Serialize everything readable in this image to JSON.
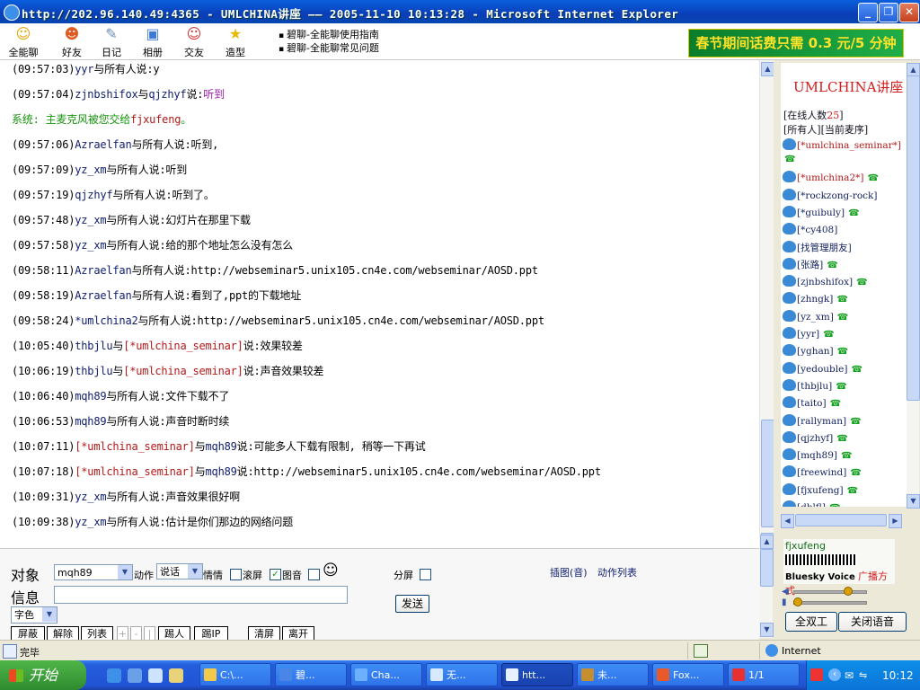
{
  "window": {
    "title": "http://202.96.140.49:4365 - UMLCHINA讲座 —— 2005-11-10 10:13:28 - Microsoft Internet Explorer"
  },
  "toolbar": {
    "items": [
      {
        "label": "全能聊",
        "icon": "smile-icon"
      },
      {
        "label": "好友",
        "icon": "friends-icon"
      },
      {
        "label": "日记",
        "icon": "diary-icon"
      },
      {
        "label": "相册",
        "icon": "album-icon"
      },
      {
        "label": "交友",
        "icon": "dating-icon"
      },
      {
        "label": "造型",
        "icon": "star-icon"
      }
    ],
    "help_links": [
      "碧聊-全能聊使用指南",
      "碧聊-全能聊常见问题"
    ],
    "ad_text": "春节期间话费只需 0.3 元/5 分钟"
  },
  "chat": {
    "messages": [
      {
        "time": "(09:57:03)",
        "from": "yyr",
        "mid": "与所有人说:",
        "to": "",
        "mid2": "",
        "text": "y",
        "text_color": "black"
      },
      {
        "time": "(09:57:04)",
        "from": "zjnbshifox",
        "mid": "与",
        "to": "qjzhyf",
        "mid2": "说:",
        "text": "听到",
        "text_color": "purple"
      },
      {
        "time": "",
        "system": "系统:  主麦克风被您交给",
        "system_name": "fjxufeng",
        "system_end": "。"
      },
      {
        "time": "(09:57:06)",
        "from": "Azraelfan",
        "mid": "与所有人说:",
        "to": "",
        "mid2": "",
        "text": "听到,",
        "text_color": "black"
      },
      {
        "time": "(09:57:09)",
        "from": "yz_xm",
        "mid": "与所有人说:",
        "to": "",
        "mid2": "",
        "text": "听到",
        "text_color": "black"
      },
      {
        "time": "(09:57:19)",
        "from": "qjzhyf",
        "mid": "与所有人说:",
        "to": "",
        "mid2": "",
        "text": "听到了。",
        "text_color": "black"
      },
      {
        "time": "(09:57:48)",
        "from": "yz_xm",
        "mid": "与所有人说:",
        "to": "",
        "mid2": "",
        "text": "幻灯片在那里下载",
        "text_color": "black"
      },
      {
        "time": "(09:57:58)",
        "from": "yz_xm",
        "mid": "与所有人说:",
        "to": "",
        "mid2": "",
        "text": "给的那个地址怎么没有怎么",
        "text_color": "black"
      },
      {
        "time": "(09:58:11)",
        "from": "Azraelfan",
        "mid": "与所有人说:",
        "to": "",
        "mid2": "",
        "text": "http://webseminar5.unix105.cn4e.com/webseminar/AOSD.ppt",
        "text_color": "black"
      },
      {
        "time": "(09:58:19)",
        "from": "Azraelfan",
        "mid": "与所有人说:",
        "to": "",
        "mid2": "",
        "text": "看到了,ppt的下载地址",
        "text_color": "black"
      },
      {
        "time": "(09:58:24)",
        "from": "*umlchina2",
        "mid": "与所有人说:",
        "to": "",
        "mid2": "",
        "text": "http://webseminar5.unix105.cn4e.com/webseminar/AOSD.ppt",
        "text_color": "black"
      },
      {
        "time": "(10:05:40)",
        "from": "thbjlu",
        "mid": "与",
        "to": "[*umlchina_seminar]",
        "mid2": "说:",
        "text": "效果较差",
        "text_color": "black"
      },
      {
        "time": "(10:06:19)",
        "from": "thbjlu",
        "mid": "与",
        "to": "[*umlchina_seminar]",
        "mid2": "说:",
        "text": "声音效果较差",
        "text_color": "black"
      },
      {
        "time": "(10:06:40)",
        "from": "mqh89",
        "mid": "与所有人说:",
        "to": "",
        "mid2": "",
        "text": "文件下载不了",
        "text_color": "black"
      },
      {
        "time": "(10:06:53)",
        "from": "mqh89",
        "mid": "与所有人说:",
        "to": "",
        "mid2": "",
        "text": "声音时断时续",
        "text_color": "black"
      },
      {
        "time": "(10:07:11)",
        "from": "[*umlchina_seminar]",
        "mid": "与",
        "to": "mqh89",
        "mid2": "说:",
        "text": "可能多人下载有限制, 稍等一下再试",
        "text_color": "black",
        "from_red": true
      },
      {
        "time": "(10:07:18)",
        "from": "[*umlchina_seminar]",
        "mid": "与",
        "to": "mqh89",
        "mid2": "说:",
        "text": "http://webseminar5.unix105.cn4e.com/webseminar/AOSD.ppt",
        "text_color": "black",
        "from_red": true
      },
      {
        "time": "(10:09:31)",
        "from": "yz_xm",
        "mid": "与所有人说:",
        "to": "",
        "mid2": "",
        "text": "声音效果很好啊",
        "text_color": "black"
      },
      {
        "time": "(10:09:38)",
        "from": "yz_xm",
        "mid": "与所有人说:",
        "to": "",
        "mid2": "",
        "text": "估计是你们那边的网络问题",
        "text_color": "black"
      }
    ]
  },
  "users_panel": {
    "room_title": "UMLCHINA讲座",
    "online_prefix": "[在线人数",
    "online_count": "25",
    "online_suffix": "]",
    "link_all": "[所有人]",
    "link_queue": "[当前麦序]",
    "users": [
      {
        "name": "[*umlchina_seminar*]",
        "red": true,
        "phone": true,
        "phone_next_line": true
      },
      {
        "name": "[*umlchina2*]",
        "red": true,
        "phone": true
      },
      {
        "name": "[*rockzong-rock]",
        "red": false,
        "phone": false
      },
      {
        "name": "[*guibuly]",
        "red": false,
        "phone": true
      },
      {
        "name": "[*cy408]",
        "red": false,
        "phone": false
      },
      {
        "name": "[找管理朋友]",
        "red": false,
        "phone": false
      },
      {
        "name": "[张路]",
        "red": false,
        "phone": true
      },
      {
        "name": "[zjnbshifox]",
        "red": false,
        "phone": true
      },
      {
        "name": "[zhngk]",
        "red": false,
        "phone": true
      },
      {
        "name": "[yz_xm]",
        "red": false,
        "phone": true
      },
      {
        "name": "[yyr]",
        "red": false,
        "phone": true
      },
      {
        "name": "[yghan]",
        "red": false,
        "phone": true
      },
      {
        "name": "[yedouble]",
        "red": false,
        "phone": true
      },
      {
        "name": "[thbjlu]",
        "red": false,
        "phone": true
      },
      {
        "name": "[taito]",
        "red": false,
        "phone": true
      },
      {
        "name": "[rallyman]",
        "red": false,
        "phone": true
      },
      {
        "name": "[qjzhyf]",
        "red": false,
        "phone": true
      },
      {
        "name": "[mqh89]",
        "red": false,
        "phone": true
      },
      {
        "name": "[freewind]",
        "red": false,
        "phone": true
      },
      {
        "name": "[fjxufeng]",
        "red": false,
        "phone": true
      },
      {
        "name": "[dblfl]",
        "red": false,
        "phone": true
      }
    ]
  },
  "speaker": {
    "name": "fjxufeng",
    "brand": "Bluesky Voice",
    "mode": "广播方式",
    "full_duplex": "全双工",
    "close_voice": "关闭语音"
  },
  "input": {
    "target_label": "对象",
    "target_value": "mqh89",
    "action_label": "动作",
    "action_value": "说话",
    "mood_label": "情情",
    "scroll_label": "滚屏",
    "image_sound_label": "图音",
    "split_label": "分屏",
    "insert_link": "插图(音)",
    "action_list_link": "动作列表",
    "message_label": "信息",
    "message_value": "",
    "font_color_label": "字色",
    "send_label": "发送",
    "bottom_buttons": [
      "屏蔽",
      "解除",
      "列表",
      "踢人",
      "踢IP",
      "清屏",
      "离开"
    ],
    "small_buttons": [
      "+",
      "-",
      "|"
    ]
  },
  "status": {
    "text": "完毕",
    "zone": "Internet"
  },
  "taskbar": {
    "start_label": "开始",
    "tasks": [
      {
        "label": "C:\\...",
        "active": false
      },
      {
        "label": "碧...",
        "active": false
      },
      {
        "label": "Cha...",
        "active": false
      },
      {
        "label": "无...",
        "active": false
      },
      {
        "label": "htt...",
        "active": true
      },
      {
        "label": "未...",
        "active": false
      },
      {
        "label": "Fox...",
        "active": false
      },
      {
        "label": "1/1",
        "active": false
      }
    ],
    "clock": "10:12"
  }
}
